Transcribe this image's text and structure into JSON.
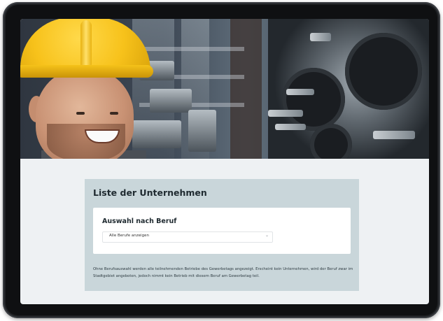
{
  "page": {
    "heading": "Liste der Unternehmen"
  },
  "filter": {
    "title": "Auswahl nach Beruf",
    "select_value": "Alle Berufe anzeigen"
  },
  "info": {
    "text": "Ohne Berufsauswahl werden alle teilnehmenden Betriebe des Gewerbetags angezeigt. Erscheint kein Unternehmen, wird der Beruf zwar im Stadtgebiet angeboten, jedoch nimmt kein Betrieb mit diesem Beruf am Gewerbetag teil."
  },
  "icons": {
    "select_arrow": "chevron-down-icon"
  },
  "colors": {
    "content_box": "#c9d6da",
    "screen_background": "#eef1f3",
    "helmet": "#f7c21b",
    "frame": "#1f2124"
  }
}
